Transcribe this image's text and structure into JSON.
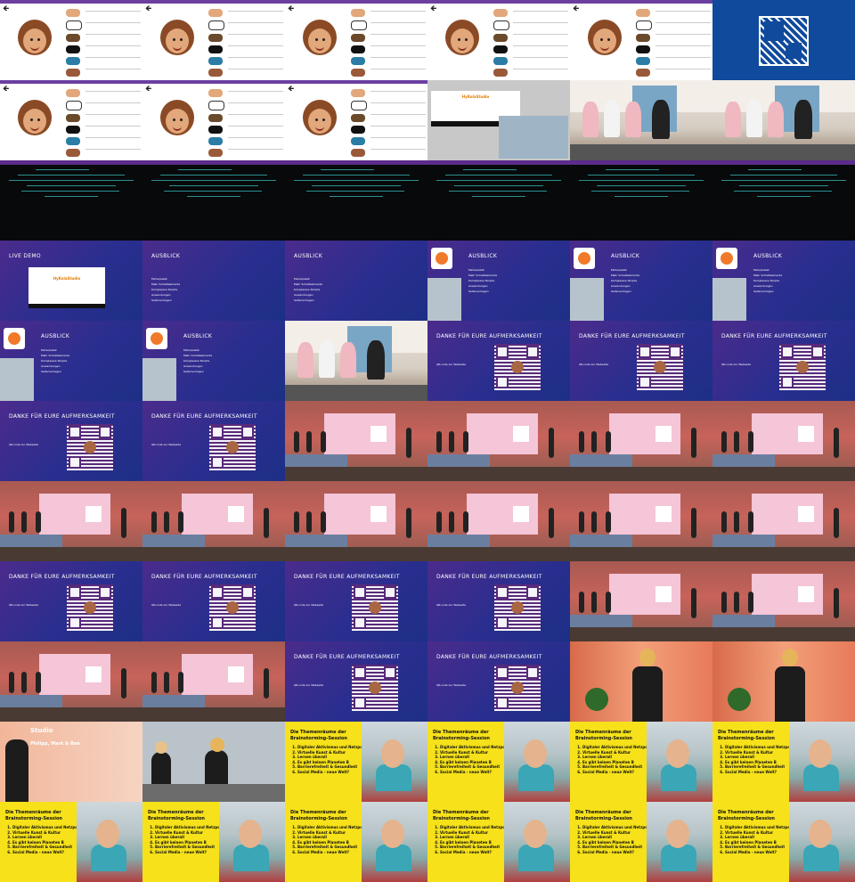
{
  "cells": [
    "avatar",
    "avatar",
    "avatar",
    "avatar",
    "avatar",
    "logo",
    "avatar",
    "avatar",
    "avatar",
    "appwin",
    "stage",
    "stage",
    "term",
    "term",
    "term",
    "term",
    "term",
    "term",
    "livedemo",
    "ausblick",
    "ausblick",
    "ausblick_cam",
    "ausblick_cam",
    "ausblick_cam",
    "ausblick_cam",
    "ausblick_cam",
    "stage",
    "danke",
    "danke",
    "danke",
    "danke",
    "danke",
    "room",
    "room",
    "room",
    "room",
    "room",
    "room",
    "room",
    "room",
    "room",
    "room",
    "danke",
    "danke",
    "danke",
    "danke",
    "room",
    "room",
    "room",
    "room",
    "danke",
    "danke",
    "speaker",
    "speaker",
    "overlay",
    "booth",
    "yellow",
    "yellow",
    "yellow",
    "yellow",
    "yellow",
    "yellow",
    "yellow",
    "yellow",
    "yellow",
    "yellow"
  ],
  "avatar": {
    "back_glyph": "🡸"
  },
  "appwin": {
    "title": "HyKolaStudio",
    "subtitle": ""
  },
  "livedemo": {
    "title": "LIVE DEMO",
    "app_title": "HyKolaStudio"
  },
  "ausblick": {
    "title": "AUSBLICK",
    "bullets": [
      "Fehlerpaket",
      "Mehr Schaltelemente",
      "Komplexere Skripte",
      "Anwendungen",
      "Seitenvorlagen"
    ]
  },
  "danke": {
    "title": "DANKE FÜR EURE AUFMERKSAMKEIT",
    "bullet": "QR-code zur Webseite"
  },
  "overlay": {
    "line1": "Studio",
    "line2": "Philipp, Mark & Ben"
  },
  "yellow": {
    "title": "Die Themenräume der Brainstorming-Session",
    "items": [
      "Digitaler Aktivismus und Netzpolitik",
      "Virtuelle Kunst & Kultur",
      "Lernen überall",
      "Es gibt keinen Planeten B",
      "Barrierefreiheit & Gesundheit",
      "Social Media - neue Welt?"
    ],
    "tag": ""
  }
}
